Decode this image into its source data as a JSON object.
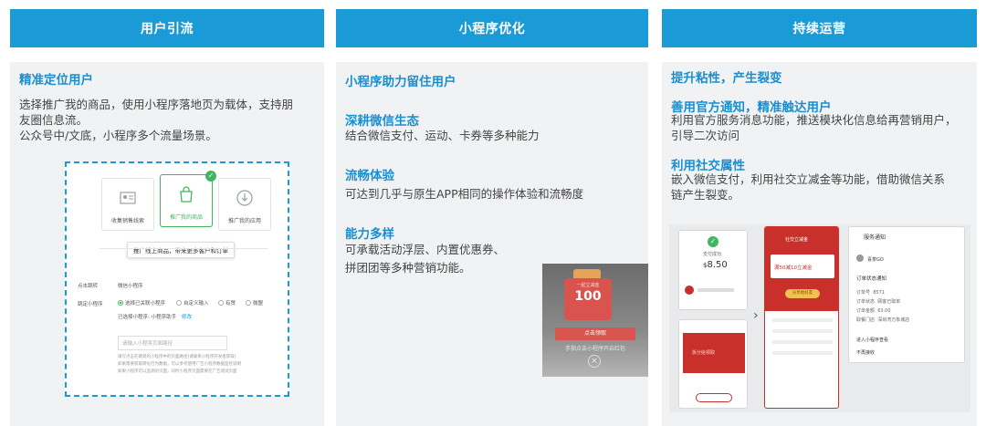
{
  "columns": [
    {
      "header": "用户引流",
      "sections": [
        {
          "title": "精准定位用户",
          "lines": [
            "选择推广我的商品，使用小程序落地页为载体，支持朋",
            "友圈信息流。",
            "公众号中/文底，小程序多个流量场景。"
          ]
        }
      ]
    },
    {
      "header": "小程序优化",
      "sections": [
        {
          "title": "小程序助力留住用户"
        },
        {
          "title": "深耕微信生态",
          "text": "结合微信支付、运动、卡券等多种能力"
        },
        {
          "title": "流畅体验",
          "text": "可达到几乎与原生APP相同的操作体验和流畅度"
        },
        {
          "title": "能力多样",
          "lines": [
            "可承载活动浮层、内置优惠券、",
            "拼团团等多种营销功能。"
          ]
        }
      ]
    },
    {
      "header": "持续运营",
      "sections": [
        {
          "title": "提升粘性，产生裂变"
        },
        {
          "title": "善用官方通知，精准触达用户",
          "lines": [
            "利用官方服务消息功能，推送模块化信息给再营销用户，",
            "引导二次访问"
          ]
        },
        {
          "title": "利用社交属性",
          "lines": [
            "嵌入微信支付，利用社交立减金等功能，借助微信关系",
            "链产生裂变。"
          ]
        }
      ]
    }
  ],
  "mockup1": {
    "tiles": [
      "收集销售线索",
      "推广我的商品",
      "推广我的应用"
    ],
    "tooltip": "推广线上商品，带来更多客户和订单",
    "row1_label": "点击跳转",
    "row1_value": "微信小程序",
    "row2_label": "跳定小程序",
    "row2_options": [
      "选择已关联小程序",
      "自定义输入",
      "有赞",
      "微盟"
    ],
    "row3_text": "已选择小程序: 小程序助手",
    "row3_link": "修改",
    "input_placeholder": "请输入小程序页面路径",
    "hint1": "填写点击在跳转的小程序中的页面路径(请联系小程序开发者获取)",
    "hint2": "如果需要获取转化行为数据，可以参考使用广告小程序数据监控说明",
    "hint3": "如果小程序可以监测的页面，同时小程序页面需要在广告测试页面"
  },
  "promo": {
    "amount": "100",
    "top_text": "一起立减金",
    "button": "点击领取",
    "caption": "手指点击小程序开启红包"
  },
  "phones": {
    "pay_amount": "8.50",
    "pay_currency": "$",
    "pay_label": "支付成功",
    "red_title": "社交立减金",
    "red_big": "满50减10立减金",
    "red_btn": "分享给好友",
    "red2_text": "拆分给领取",
    "notify_title": "服务通知",
    "notify_brand": "喜茶GO",
    "notify_heading": "订单状态通知",
    "notify_rows": [
      [
        "订单号",
        "8571"
      ],
      [
        "订单状态",
        "顾客已取单"
      ],
      [
        "订单金额",
        "63.00"
      ],
      [
        "取餐门店",
        "深圳湾万象城店"
      ]
    ],
    "notify_links": [
      "进入小程序查看",
      "不再接收"
    ]
  }
}
